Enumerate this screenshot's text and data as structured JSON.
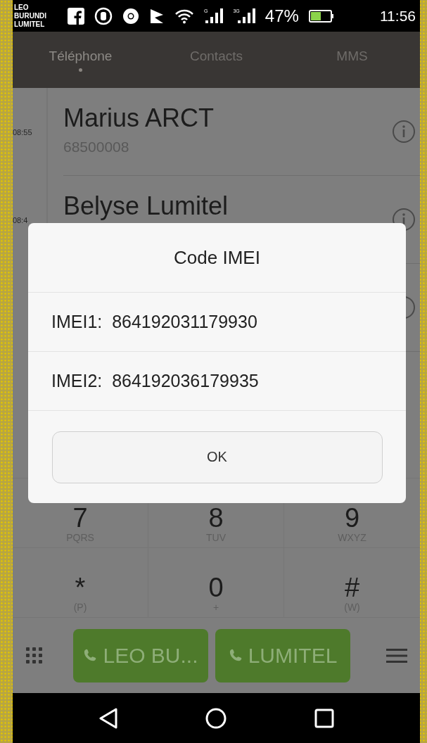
{
  "status_bar": {
    "carriers": [
      "LEO BURUNDI",
      "LUMITEL"
    ],
    "signals": [
      {
        "tag": "G"
      },
      {
        "tag": "3G"
      }
    ],
    "battery": "47%",
    "time": "11:56"
  },
  "tabs": [
    {
      "label": "Téléphone",
      "selected": true
    },
    {
      "label": "Contacts",
      "selected": false
    },
    {
      "label": "MMS",
      "selected": false
    }
  ],
  "call_log": [
    {
      "time": "08:55",
      "name": "Marius ARCT",
      "number": "68500008"
    },
    {
      "time": "08:4",
      "name": "Belyse Lumitel"
    }
  ],
  "dialog": {
    "title": "Code IMEI",
    "rows": [
      {
        "label": "IMEI1:",
        "value": "864192031179930"
      },
      {
        "label": "IMEI2:",
        "value": "864192036179935"
      }
    ],
    "button": "OK"
  },
  "keypad": [
    [
      {
        "digit": "7",
        "letters": "PQRS"
      },
      {
        "digit": "8",
        "letters": "TUV"
      },
      {
        "digit": "9",
        "letters": "WXYZ"
      }
    ],
    [
      {
        "digit": "*",
        "letters": "(P)"
      },
      {
        "digit": "0",
        "letters": "+"
      },
      {
        "digit": "#",
        "letters": "(W)"
      }
    ]
  ],
  "call_buttons": [
    "LEO BU...",
    "LUMITEL"
  ]
}
